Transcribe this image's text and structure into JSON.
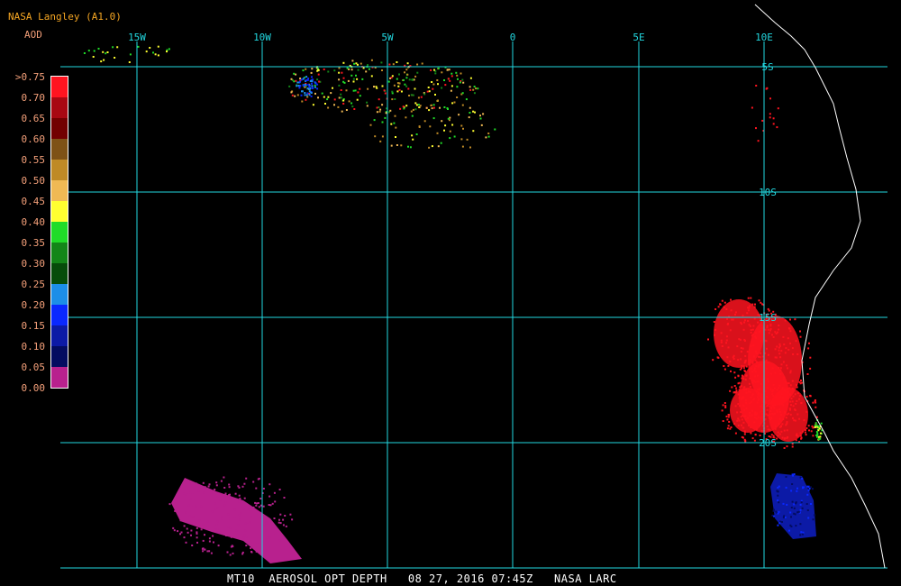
{
  "header": {
    "title": "NASA Langley (A1.0)",
    "variable": "AOD"
  },
  "colorbar": {
    "labels": [
      ">0.75",
      "0.70",
      "0.65",
      "0.60",
      "0.55",
      "0.50",
      "0.45",
      "0.40",
      "0.35",
      "0.30",
      "0.25",
      "0.20",
      "0.15",
      "0.10",
      "0.05",
      "0.00"
    ],
    "colors": [
      "#ff1420",
      "#a80812",
      "#720000",
      "#7e5216",
      "#bf8a26",
      "#f0b954",
      "#ffff30",
      "#20dc28",
      "#138618",
      "#064c0a",
      "#1c8ee8",
      "#0a28ff",
      "#0c1aa6",
      "#030c60",
      "#b8218e"
    ]
  },
  "map": {
    "lon_labels": [
      "15W",
      "10W",
      "5W",
      "0",
      "5E",
      "10E"
    ],
    "lat_labels": [
      "5S",
      "10S",
      "15S",
      "20S"
    ],
    "grid_color": "#22d8e0",
    "coast_color": "#ffffff"
  },
  "footer": {
    "text": "MT10  AEROSOL OPT DEPTH   08 27, 2016 07:45Z   NASA LARC"
  }
}
